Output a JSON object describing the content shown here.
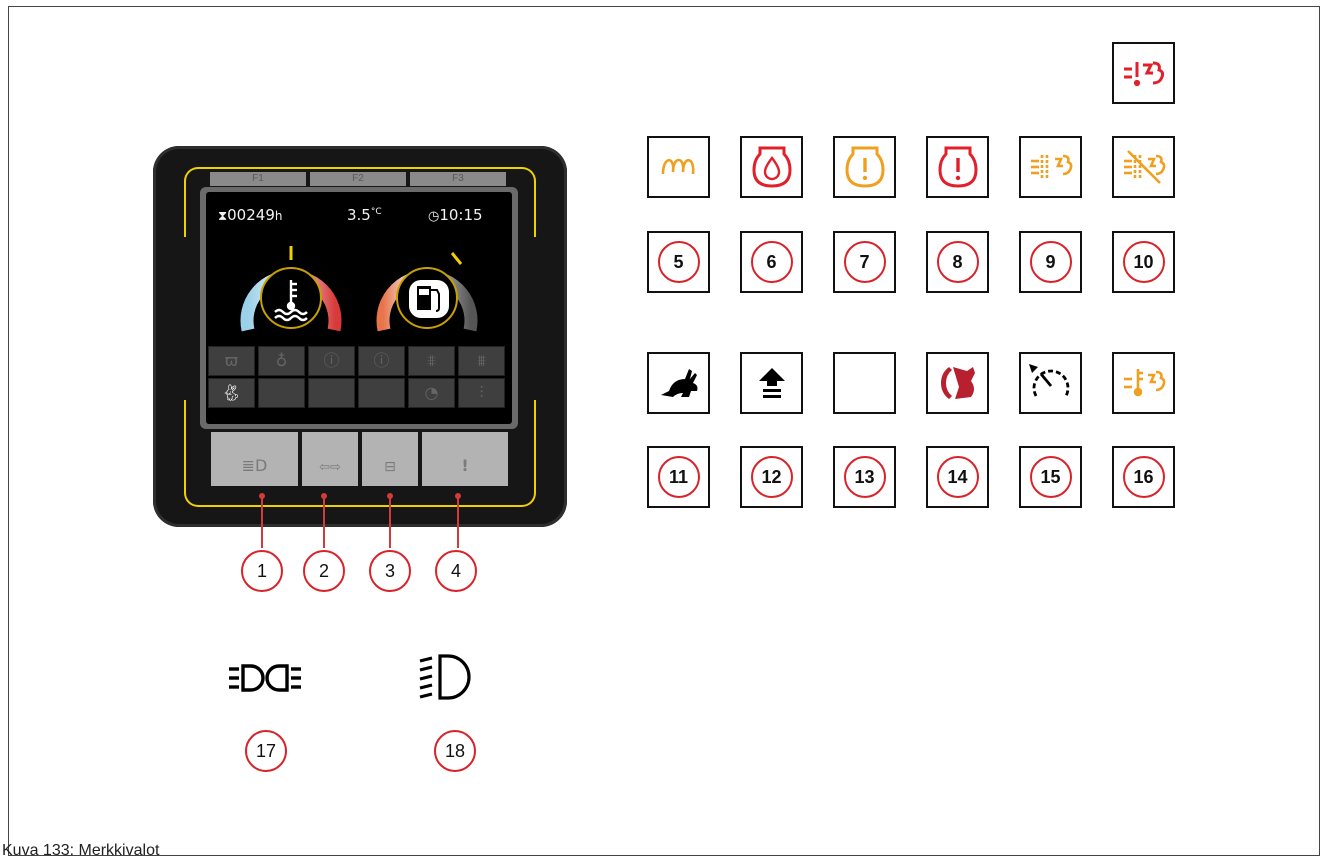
{
  "caption": "Kuva 133: Merkkivalot",
  "display": {
    "fkeys": [
      "F1",
      "F2",
      "F3"
    ],
    "hours": "00249",
    "hours_unit": "h",
    "temperature": "3.5",
    "temperature_unit": "°C",
    "clock": "10:15",
    "coolant_gauge_level": 0.5,
    "fuel_gauge_level": 0.68,
    "indicator_row1": [
      "glow-plug",
      "oil-pressure",
      "engine-warning",
      "engine-fault",
      "dpf",
      "dpf-off"
    ],
    "indicator_row2": [
      "rabbit",
      "",
      "",
      "",
      "cruise",
      "exhaust-temp"
    ],
    "bottom_keys": [
      "lights",
      "indicators",
      "battery",
      "warning"
    ]
  },
  "callouts": [
    {
      "num": "1"
    },
    {
      "num": "2"
    },
    {
      "num": "3"
    },
    {
      "num": "4"
    }
  ],
  "symbols": {
    "top_single": {
      "icon": "exhaust-warning-icon",
      "color": "#e0202a"
    },
    "row1": [
      {
        "icon": "glow-plug-icon",
        "color": "#f0a020"
      },
      {
        "icon": "oil-pressure-icon",
        "color": "#e0202a"
      },
      {
        "icon": "engine-warning-icon",
        "color": "#f0a020"
      },
      {
        "icon": "engine-fault-icon",
        "color": "#e0202a"
      },
      {
        "icon": "dpf-regeneration-icon",
        "color": "#f0a020"
      },
      {
        "icon": "dpf-disabled-icon",
        "color": "#f0a020"
      }
    ],
    "row1_numbers": [
      "5",
      "6",
      "7",
      "8",
      "9",
      "10"
    ],
    "row2": [
      {
        "icon": "rabbit-icon",
        "color": "#000000"
      },
      {
        "icon": "shift-up-icon",
        "color": "#000000"
      },
      {
        "icon": "empty",
        "color": "#ffffff"
      },
      {
        "icon": "parking-brake-icon",
        "color": "#c0202a"
      },
      {
        "icon": "speedometer-icon",
        "color": "#000000"
      },
      {
        "icon": "exhaust-temperature-icon",
        "color": "#f0a020"
      }
    ],
    "row2_numbers": [
      "11",
      "12",
      "13",
      "14",
      "15",
      "16"
    ]
  },
  "lamps": [
    {
      "icon": "working-lights-icon",
      "num": "17"
    },
    {
      "icon": "headlight-icon",
      "num": "18"
    }
  ]
}
